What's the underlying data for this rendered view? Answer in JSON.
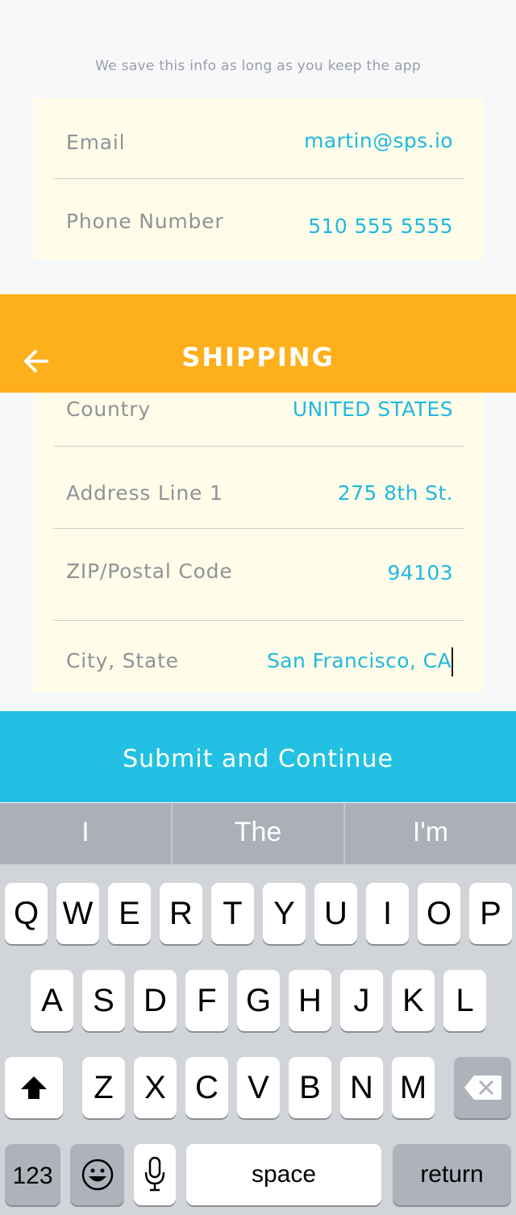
{
  "note": "We save this info as long as you keep the app",
  "contact": {
    "email_label": "Email",
    "email_value": "martin@sps.io",
    "phone_label": "Phone Number",
    "phone_value": "510 555 5555"
  },
  "header": {
    "title": "SHIPPING",
    "back_icon": "arrow-left-icon"
  },
  "shipping": {
    "country_label": "Country",
    "country_value": "UNITED STATES",
    "address_label": "Address Line 1",
    "address_value": "275 8th St.",
    "zip_label": "ZIP/Postal Code",
    "zip_value": "94103",
    "city_label": "City, State",
    "city_value": "San Francisco, CA"
  },
  "submit_label": "Submit and Continue",
  "keyboard": {
    "suggestions": [
      "I",
      "The",
      "I'm"
    ],
    "row1": [
      "Q",
      "W",
      "E",
      "R",
      "T",
      "Y",
      "U",
      "I",
      "O",
      "P"
    ],
    "row2": [
      "A",
      "S",
      "D",
      "F",
      "G",
      "H",
      "J",
      "K",
      "L"
    ],
    "row3": [
      "Z",
      "X",
      "C",
      "V",
      "B",
      "N",
      "M"
    ],
    "numbers_label": "123",
    "space_label": "space",
    "return_label": "return"
  },
  "colors": {
    "accent": "#21b8e2",
    "header": "#fdb01b",
    "submit": "#22c1e3",
    "card": "#fffde9"
  }
}
